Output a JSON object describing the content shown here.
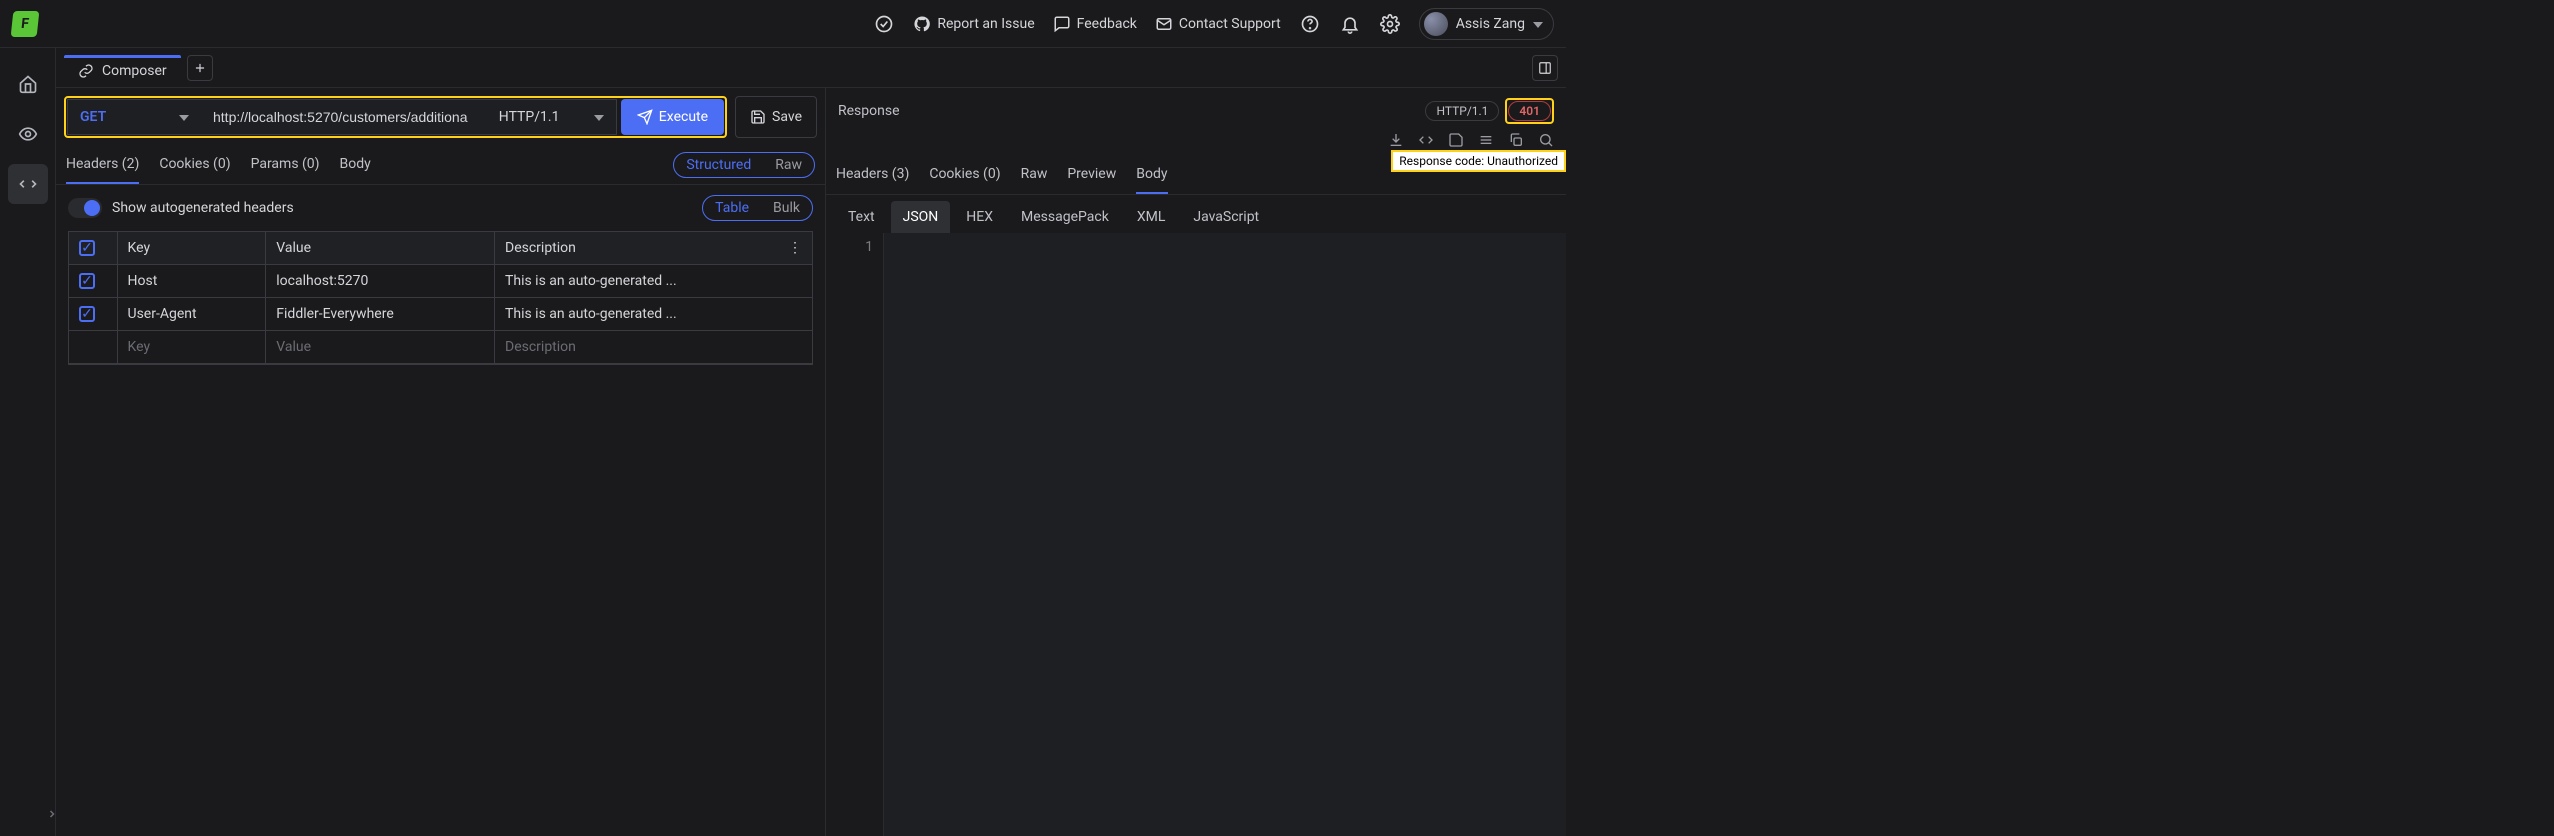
{
  "brand": {
    "letter": "F"
  },
  "topbar": {
    "report_issue": "Report an Issue",
    "feedback": "Feedback",
    "contact_support": "Contact Support",
    "username": "Assis Zang"
  },
  "tabs": {
    "composer": "Composer"
  },
  "request": {
    "method": "GET",
    "url": "http://localhost:5270/customers/additiona",
    "protocol": "HTTP/1.1",
    "execute": "Execute",
    "save": "Save"
  },
  "req_tabs": {
    "headers": "Headers (2)",
    "cookies": "Cookies (0)",
    "params": "Params (0)",
    "body": "Body",
    "structured": "Structured",
    "raw": "Raw"
  },
  "autogen": {
    "label": "Show autogenerated headers",
    "table": "Table",
    "bulk": "Bulk"
  },
  "headers_table": {
    "th_key": "Key",
    "th_value": "Value",
    "th_desc": "Description",
    "rows": [
      {
        "key": "Host",
        "value": "localhost:5270",
        "desc": "This is an auto-generated ..."
      },
      {
        "key": "User-Agent",
        "value": "Fiddler-Everywhere",
        "desc": "This is an auto-generated ..."
      }
    ],
    "ph_key": "Key",
    "ph_value": "Value",
    "ph_desc": "Description"
  },
  "response": {
    "title": "Response",
    "protocol": "HTTP/1.1",
    "code": "401",
    "tooltip": "Response code: Unauthorized",
    "tabs": {
      "headers": "Headers (3)",
      "cookies": "Cookies (0)",
      "raw": "Raw",
      "preview": "Preview",
      "body": "Body"
    },
    "body_tabs": {
      "text": "Text",
      "json": "JSON",
      "hex": "HEX",
      "msgpack": "MessagePack",
      "xml": "XML",
      "js": "JavaScript"
    },
    "editor": {
      "line1": "1"
    }
  }
}
